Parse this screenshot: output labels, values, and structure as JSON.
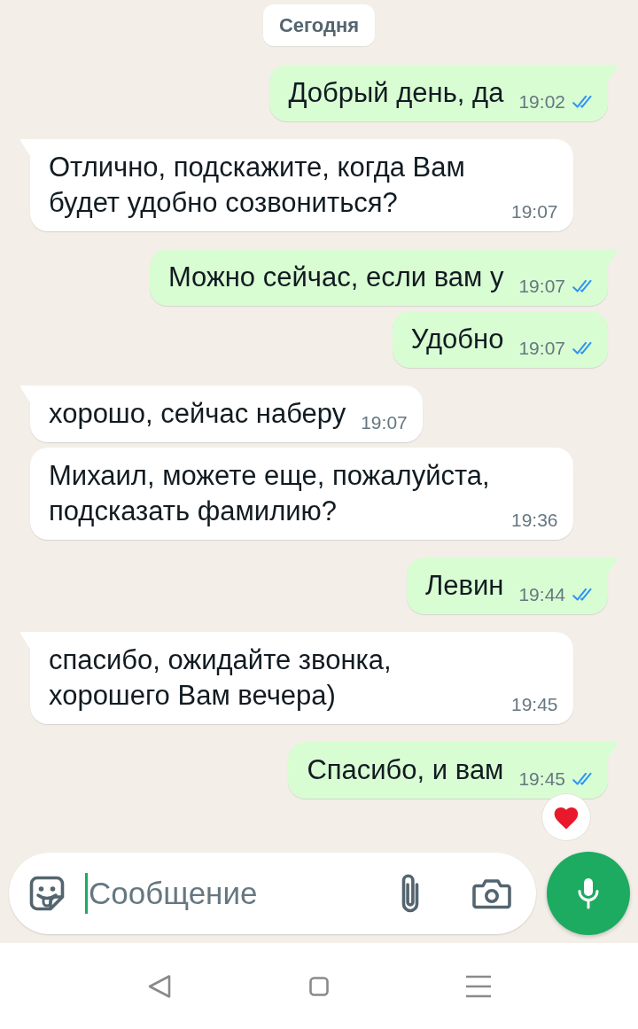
{
  "date_chip": {
    "label": "Сегодня"
  },
  "messages": [
    {
      "kind": "outgoing",
      "tail": true,
      "text": "Добрый день, да",
      "time": "19:02",
      "read": true,
      "reacted": false
    },
    {
      "kind": "incoming",
      "tail": true,
      "text": "Отлично, подскажите, когда Вам будет удобно созвониться?",
      "time": "19:07",
      "reacted": false
    },
    {
      "kind": "outgoing",
      "tail": true,
      "text": "Можно сейчас, если вам у",
      "time": "19:07",
      "read": true,
      "reacted": false
    },
    {
      "kind": "outgoing",
      "tail": false,
      "text": "Удобно",
      "time": "19:07",
      "read": true,
      "reacted": false
    },
    {
      "kind": "incoming",
      "tail": true,
      "text": "хорошо, сейчас наберу",
      "time": "19:07",
      "reacted": false
    },
    {
      "kind": "incoming",
      "tail": false,
      "text": "Михаил, можете еще, пожалуйста, подсказать фамилию?",
      "time": "19:36",
      "reacted": false
    },
    {
      "kind": "outgoing",
      "tail": true,
      "text": "Левин",
      "time": "19:44",
      "read": true,
      "reacted": false
    },
    {
      "kind": "incoming",
      "tail": true,
      "text": "спасибо, ожидайте звонка, хорошего Вам вечера)",
      "time": "19:45",
      "reacted": false
    },
    {
      "kind": "outgoing",
      "tail": true,
      "text": "Спасибо, и вам",
      "time": "19:45",
      "read": true,
      "reacted": true
    }
  ],
  "composer": {
    "placeholder": "Сообщение"
  }
}
